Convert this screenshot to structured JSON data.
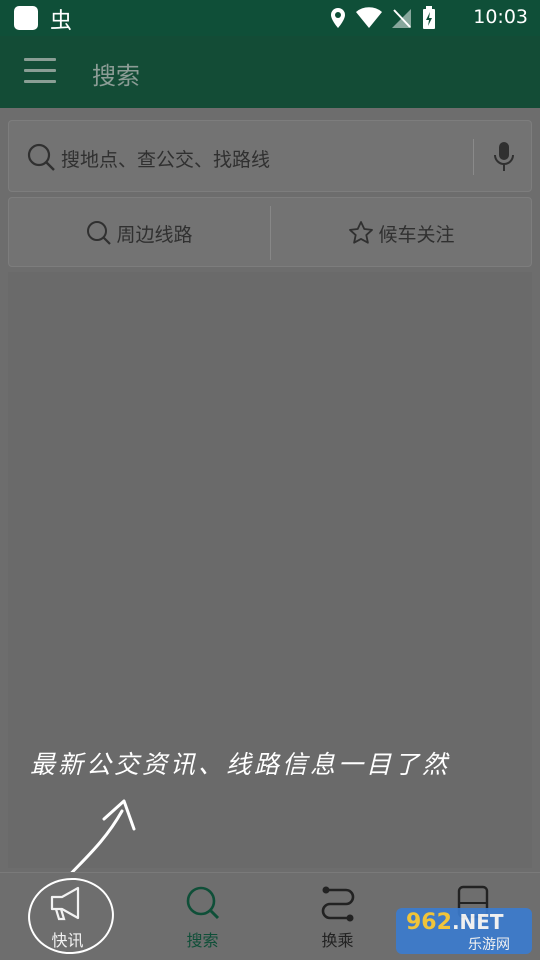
{
  "status_bar": {
    "time": "10:03",
    "app_glyph": "虫"
  },
  "app_bar": {
    "title": "搜索",
    "menu_icon": "hamburger-icon"
  },
  "search": {
    "placeholder": "搜地点、查公交、找路线"
  },
  "quick_actions": [
    {
      "label": "周边线路",
      "icon": "search-icon"
    },
    {
      "label": "候车关注",
      "icon": "star-icon"
    }
  ],
  "hint": {
    "text": "最新公交资讯、线路信息一目了然"
  },
  "bottom_nav": [
    {
      "label": "快讯",
      "icon": "megaphone-icon"
    },
    {
      "label": "搜索",
      "icon": "search-icon",
      "active": true
    },
    {
      "label": "换乘",
      "icon": "route-icon"
    },
    {
      "label": "",
      "icon": "bus-icon"
    }
  ],
  "watermark": {
    "brand": "962",
    "suffix": ".NET",
    "sub": "乐游网"
  },
  "colors": {
    "primary_dark": "#0f4f38",
    "overlay": "#6d6d6d",
    "accent_text": "#0f4f38"
  }
}
